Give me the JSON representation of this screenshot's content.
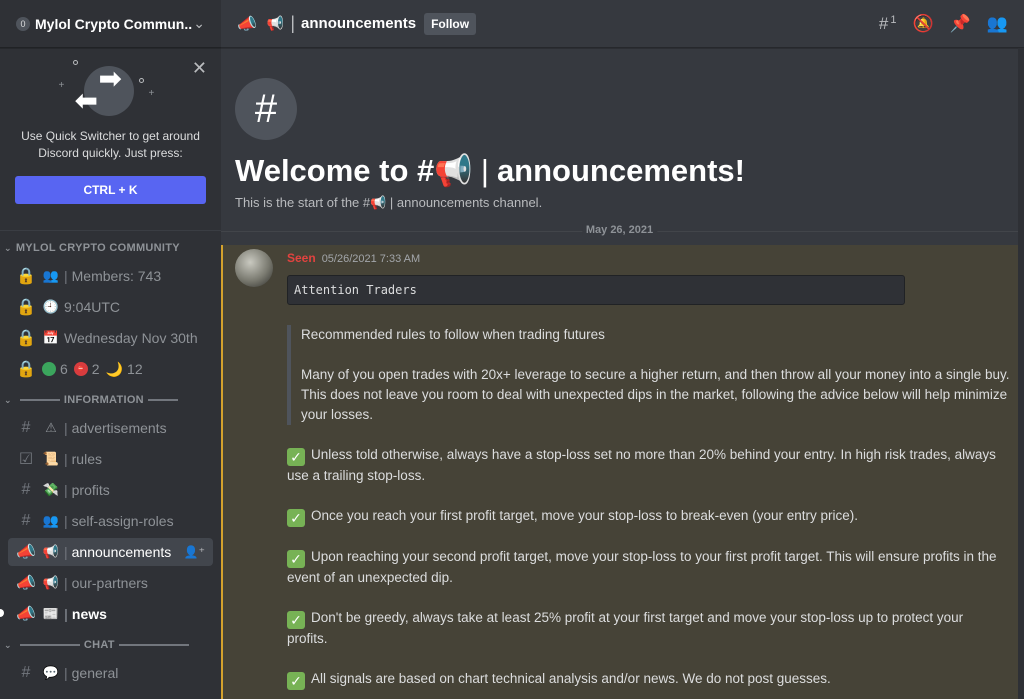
{
  "server": {
    "badge": "0",
    "name": "Mylol Crypto Commun...",
    "dropdown_icon": "chevron-down-icon"
  },
  "quick_switcher": {
    "text_line1": "Use Quick Switcher to get around",
    "text_line2": "Discord quickly. Just press:",
    "shortcut": "CTRL + K",
    "close_icon": "close-icon"
  },
  "sidebar": {
    "categories": [
      {
        "name": "MYLOL CRYPTO COMMUNITY",
        "channels": [
          {
            "type_icon": "lock-icon",
            "emoji": "👥",
            "label": "Members: 743",
            "separator": "|"
          },
          {
            "type_icon": "lock-icon",
            "emoji": "🕘",
            "label": "9:04UTC"
          },
          {
            "type_icon": "lock-icon",
            "emoji": "📅",
            "label": "Wednesday Nov 30th"
          },
          {
            "type_icon": "lock-icon",
            "status": {
              "online_count": "6",
              "dnd_count": "2",
              "idle_count": "12",
              "idle_emoji": "🌙"
            }
          }
        ]
      },
      {
        "name": "INFORMATION",
        "channels": [
          {
            "type_icon": "hash-icon",
            "emoji": "⚠",
            "label": "advertisements",
            "separator": "|"
          },
          {
            "type_icon": "rules-icon",
            "emoji": "📜",
            "label": "rules",
            "separator": "|"
          },
          {
            "type_icon": "hash-icon",
            "emoji": "💸",
            "label": "profits",
            "separator": "|"
          },
          {
            "type_icon": "hash-icon",
            "emoji": "👥",
            "label": "self-assign-roles",
            "separator": "|"
          },
          {
            "type_icon": "announcement-icon",
            "emoji": "📢",
            "label": "announcements",
            "separator": "|",
            "active": true
          },
          {
            "type_icon": "announcement-icon",
            "emoji": "📢",
            "label": "our-partners",
            "separator": "|"
          },
          {
            "type_icon": "announcement-icon",
            "emoji": "📰",
            "label": "news",
            "separator": "|",
            "unread": true
          }
        ]
      },
      {
        "name": "CHAT",
        "channels": [
          {
            "type_icon": "hash-icon",
            "emoji": "💬",
            "label": "general",
            "separator": "|"
          }
        ]
      }
    ]
  },
  "topbar": {
    "channel_emoji": "📢",
    "separator": "|",
    "channel_name": "announcements",
    "follow_label": "Follow",
    "threads_count": "1",
    "icons": [
      "threads-icon",
      "mute-bell-icon",
      "pin-icon",
      "members-icon"
    ]
  },
  "welcome": {
    "title_prefix": "Welcome to #",
    "title_emoji": "📢",
    "title_separator": "|",
    "title_name": "announcements!",
    "subtitle": "This is the start of the #📢 | announcements channel."
  },
  "date_divider": "May 26, 2021",
  "message": {
    "author": "Seen",
    "timestamp": "05/26/2021 7:33 AM",
    "code_block": "Attention Traders",
    "quote": [
      "Recommended rules to follow when trading futures",
      "Many of you open trades with 20x+ leverage to secure a higher return, and then throw all your money into a single buy. This does not leave you room to deal with unexpected dips in the market, following the advice below will help minimize your losses."
    ],
    "rules": [
      "Unless told otherwise, always have a stop-loss set no more than 20% behind your entry. In high risk trades, always use a trailing stop-loss.",
      "Once you reach your first profit target, move your stop-loss to break-even (your entry price).",
      "Upon reaching your second profit target, move your stop-loss to your first profit target. This will ensure profits in the event of an unexpected dip.",
      "Don't be greedy, always take at least 25% profit at your first target and move your stop-loss up to protect your profits.",
      "All signals are based on chart technical analysis and/or news. We do not post guesses."
    ]
  },
  "colors": {
    "blurple": "#5865f2",
    "highlight_bg": "#464337",
    "highlight_border": "#d4a22d",
    "author_red": "#e2433f",
    "check_green": "#77b255"
  }
}
